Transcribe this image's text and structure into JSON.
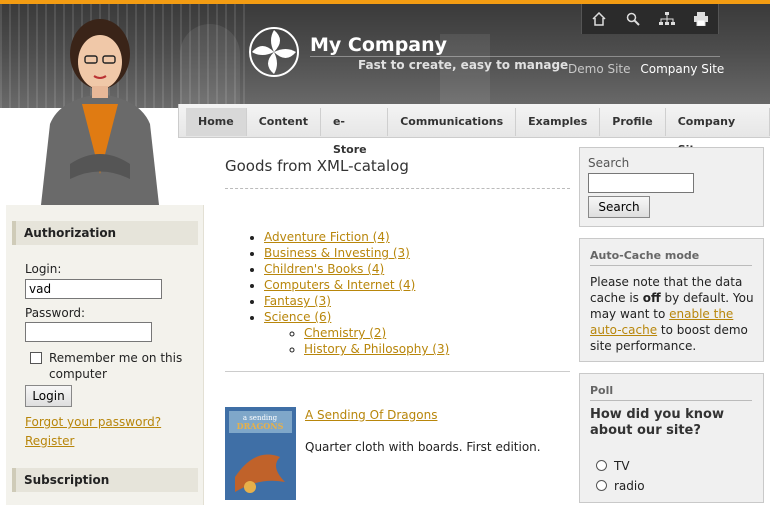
{
  "header": {
    "brand": "My Company",
    "tagline": "Fast to create, easy to manage",
    "links": [
      "Demo Site",
      "Company Site"
    ],
    "tools": [
      "home-icon",
      "search-icon",
      "sitemap-icon",
      "print-icon"
    ]
  },
  "nav": {
    "tabs": [
      {
        "label": "Home",
        "active": true
      },
      {
        "label": "Content"
      },
      {
        "label": "e-Store"
      },
      {
        "label": "Communications"
      },
      {
        "label": "Examples"
      },
      {
        "label": "Profile"
      },
      {
        "label": "Company Site"
      }
    ]
  },
  "auth": {
    "title": "Authorization",
    "login_label": "Login:",
    "login_value": "vad",
    "password_label": "Password:",
    "remember": "Remember me on this computer",
    "button": "Login",
    "forgot": "Forgot your password?",
    "register": "Register"
  },
  "subscription": {
    "title": "Subscription"
  },
  "main": {
    "title": "Goods from XML-catalog",
    "categories": [
      "Adventure Fiction (4)",
      "Business & Investing (3)",
      "Children's Books (4)",
      "Computers & Internet (4)",
      "Fantasy (3)",
      "Science (6)"
    ],
    "subcategories": [
      "Chemistry (2)",
      "History & Philosophy (3)"
    ],
    "book": {
      "title": "A Sending Of Dragons",
      "description": "Quarter cloth with boards. First edition."
    }
  },
  "search": {
    "label": "Search",
    "button": "Search"
  },
  "cache": {
    "title": "Auto-Cache mode",
    "text_1": "Please note that the data cache is ",
    "text_bold": "off",
    "text_2": " by default. You may want to ",
    "link": "enable the auto-cache",
    "text_3": " to boost demo site performance."
  },
  "poll": {
    "title": "Poll",
    "question": "How did you know about our site?",
    "options": [
      "TV",
      "radio"
    ]
  },
  "colors": {
    "accent": "#f39c12",
    "link": "#b8860b"
  }
}
